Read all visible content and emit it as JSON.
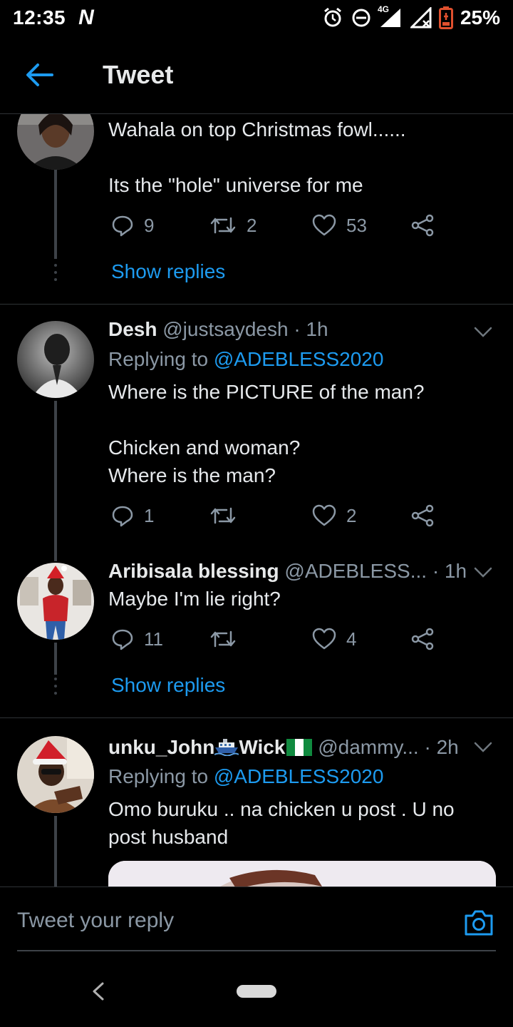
{
  "status_bar": {
    "time": "12:35",
    "carrier_mark": "N",
    "network_label": "4G",
    "battery": "25%"
  },
  "header": {
    "title": "Tweet"
  },
  "tweets": [
    {
      "text_lines": [
        "Wahala on top Christmas fowl......",
        "Its the \"hole\" universe for me"
      ],
      "replies": "9",
      "retweets": "2",
      "likes": "53",
      "show_replies": "Show replies"
    },
    {
      "display_name": "Desh",
      "handle": "@justsaydesh",
      "time": "· 1h",
      "replying_prefix": "Replying to",
      "replying_to": "@ADEBLESS2020",
      "text_lines": [
        "Where is the PICTURE of the man?",
        "Chicken and woman?",
        "Where is the man?"
      ],
      "replies": "1",
      "retweets": "",
      "likes": "2"
    },
    {
      "display_name": "Aribisala blessing",
      "handle": "@ADEBLESS...",
      "time": "· 1h",
      "text_lines": [
        "Maybe I'm lie right?"
      ],
      "replies": "11",
      "retweets": "",
      "likes": "4",
      "show_replies": "Show replies"
    },
    {
      "display_name_part1": "unku_John",
      "display_name_part2": "Wick",
      "handle": "@dammy...",
      "time": "· 2h",
      "replying_prefix": "Replying to",
      "replying_to": "@ADEBLESS2020",
      "text_lines": [
        "Omo buruku .. na chicken u post . U no",
        "post husband"
      ]
    }
  ],
  "reply_bar": {
    "placeholder": "Tweet your reply"
  },
  "icons": {
    "back": "arrow-left-icon",
    "reply": "comment-bubble-icon",
    "retweet": "retweet-icon",
    "like": "heart-icon",
    "share": "share-icon",
    "caret": "chevron-down-icon",
    "camera": "camera-icon"
  },
  "colors": {
    "background": "#000000",
    "accent": "#1d9bf0",
    "muted": "#8b98a5",
    "divider": "#2f3336",
    "battery_warning": "#e0502e"
  }
}
